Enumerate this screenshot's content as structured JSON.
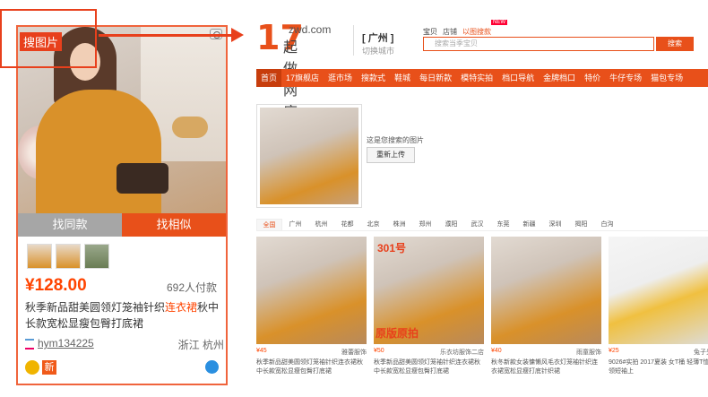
{
  "card": {
    "same_btn": "找同款",
    "similar_btn": "找相似",
    "price": "¥128.00",
    "sales": "692人付款",
    "title_a": "秋季新品甜美圆领灯笼袖针织",
    "title_hl": "连衣裙",
    "title_b": "秋中长款宽松显瘦包臀打底裙",
    "shop_name": "hym134225",
    "location": "浙江 杭州",
    "new_badge": "新"
  },
  "annotation": {
    "label": "搜图片"
  },
  "site": {
    "logo_num": "17",
    "logo_domain": "zwd.com",
    "logo_cn": "起做网店",
    "city": "[ 广州 ]",
    "city_switch": "切换城市",
    "search_tabs": [
      "宝贝",
      "店铺",
      "以图搜款"
    ],
    "new_tag": "NEW",
    "search_placeholder": "搜索当季宝贝",
    "search_btn": "搜索",
    "nav": [
      "首页",
      "17旗舰店",
      "逛市场",
      "搜款式",
      "鞋城",
      "每日新款",
      "模特实拍",
      "档口导航",
      "金牌档口",
      "特价",
      "牛仔专场",
      "猫包专场"
    ],
    "query_caption": "这是您搜索的图片",
    "reupload": "重新上传",
    "city_filters": [
      "全国",
      "广州",
      "杭州",
      "花都",
      "北京",
      "株洲",
      "郑州",
      "濮阳",
      "武汉",
      "东莞",
      "新疆",
      "深圳",
      "揭阳",
      "白沟"
    ]
  },
  "results": [
    {
      "price": "¥45",
      "shop": "雅蕾服饰",
      "title": "秋季新品甜美圆领灯笼袖针织连衣裙秋中长款宽松显瘦包臀打底裙",
      "overlay": "",
      "overlay2": ""
    },
    {
      "price": "¥50",
      "shop": "乐衣坊服饰二店",
      "title": "秋季新品甜美圆领灯笼袖针织连衣裙秋中长款宽松显瘦包臀打底裙",
      "overlay": "301号",
      "overlay2": "原版原拍"
    },
    {
      "price": "¥40",
      "shop": "雨童服饰",
      "title": "秋冬新款女装慵懒风毛衣灯笼袖针织连衣裙宽松显瘦打底针织裙",
      "overlay": "",
      "overlay2": ""
    },
    {
      "price": "¥25",
      "shop": "兔子先森",
      "title": "9026#实拍 2017夏装 女T桶 轻薄T恤 V领短袖上",
      "overlay": "",
      "overlay2": ""
    }
  ]
}
